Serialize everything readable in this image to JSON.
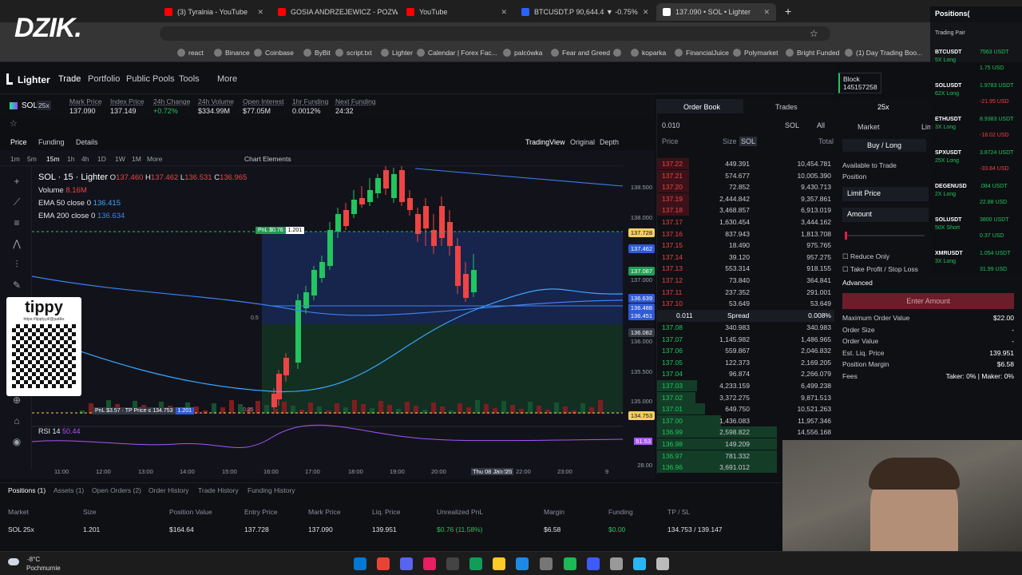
{
  "browser": {
    "tabs": [
      {
        "title": "(3) Tyralnia - YouTube",
        "fav": "#ff0000"
      },
      {
        "title": "GOSIA ANDRZEJEWICZ - POZW",
        "fav": "#ff0000"
      },
      {
        "title": "YouTube",
        "fav": "#ff0000"
      },
      {
        "title": "BTCUSDT.P 90,644.4 ▼ -0.75%",
        "fav": "#2962ff"
      },
      {
        "title": "137.090 • SOL • Lighter",
        "fav": "#ffffff"
      }
    ],
    "bookmarks": [
      "react",
      "Binance",
      "Coinbase",
      "ByBit",
      "script.txt",
      "Lighter",
      "Calendar | Forex Fac...",
      "palcówka",
      "Fear and Greed",
      "",
      "koparka",
      "FinancialJuice",
      "Polymarket",
      "Bright Funded",
      "(1) Day Trading Boo..."
    ],
    "watermark": "DZIK."
  },
  "nav": {
    "brand": "Lighter",
    "items": [
      "Trade",
      "Portfolio",
      "Public Pools",
      "Tools",
      "More"
    ],
    "block_label": "Block",
    "block_number": "145157258"
  },
  "market": {
    "symbol": "SOL",
    "leverage": "25x",
    "stats": [
      {
        "k": "Mark Price",
        "v": "137.090",
        "c": "#e2e4ea"
      },
      {
        "k": "Index Price",
        "v": "137.149",
        "c": "#e2e4ea"
      },
      {
        "k": "24h Change",
        "v": "+0.72%",
        "c": "#22c55e"
      },
      {
        "k": "24h Volume",
        "v": "$334.99M",
        "c": "#e2e4ea"
      },
      {
        "k": "Open Interest",
        "v": "$77.05M",
        "c": "#e2e4ea"
      },
      {
        "k": "1hr Funding",
        "v": "0.0012%",
        "c": "#e2e4ea"
      },
      {
        "k": "Next Funding",
        "v": "24:32",
        "c": "#e2e4ea"
      }
    ]
  },
  "chart_tabs": {
    "left": [
      "Price",
      "Funding",
      "Details"
    ],
    "right": [
      "TradingView",
      "Original",
      "Depth"
    ]
  },
  "chart_toolbar": {
    "intervals": [
      "1m",
      "5m",
      "15m",
      "1h",
      "4h",
      "1D",
      "1W",
      "1M",
      "More"
    ],
    "elements": "Chart Elements"
  },
  "chart_legend": {
    "title": "SOL · 15 · Lighter",
    "o": "137.460",
    "h": "137.462",
    "l": "136.531",
    "c": "136.965",
    "volume_label": "Volume",
    "volume": "8.16M",
    "ema50_label": "EMA 50 close 0",
    "ema50": "136.415",
    "ema200_label": "EMA 200 close 0",
    "ema200": "136.634",
    "rsi_label": "RSI 14",
    "rsi": "50.44"
  },
  "chart_data": {
    "type": "candlestick",
    "title": "SOL · 15 · Lighter",
    "x_ticks": [
      "11:00",
      "12:00",
      "13:00",
      "14:00",
      "15:00",
      "16:00",
      "17:00",
      "18:00",
      "19:00",
      "20:00",
      "Thu 08 Jan '26",
      "21:00",
      "22:00",
      "23:00",
      "9"
    ],
    "y_ticks": [
      "138.500",
      "138.000",
      "137.500",
      "137.000",
      "136.500",
      "136.000",
      "135.500",
      "135.000"
    ],
    "price_labels": [
      {
        "v": "137.728",
        "c": "#111111",
        "bg": "#f5d061"
      },
      {
        "v": "137.462",
        "c": "#ffffff",
        "bg": "#2f5bd6"
      },
      {
        "v": "137.087",
        "c": "#ffffff",
        "bg": "#1f9d55"
      },
      {
        "v": "136.639",
        "c": "#ffffff",
        "bg": "#2f5bd6"
      },
      {
        "v": "136.488",
        "c": "#ffffff",
        "bg": "#2f5bd6"
      },
      {
        "v": "136.451",
        "c": "#ffffff",
        "bg": "#2f5bd6"
      },
      {
        "v": "136.082",
        "c": "#ffffff",
        "bg": "#333844"
      },
      {
        "v": "134.753",
        "c": "#111111",
        "bg": "#f5d061"
      }
    ],
    "position_line": {
      "label": "PnL $0.76",
      "size": "1.201"
    },
    "tp_line": {
      "label": "PnL $3.57 · TP Price ≤ 134.753",
      "size": "1.201"
    },
    "rsi_ticks": [
      "51.53",
      "28.00"
    ],
    "fib": [
      "0.5",
      "0.25"
    ]
  },
  "orderbook": {
    "tabs": [
      "Order Book",
      "Trades"
    ],
    "tick": "0.010",
    "asset": "SOL",
    "filter": "All",
    "cols": [
      "Price",
      "Size",
      "SOL",
      "Total"
    ],
    "asks": [
      [
        "137.22",
        "449.391",
        "10,454.781"
      ],
      [
        "137.21",
        "574.677",
        "10,005.390"
      ],
      [
        "137.20",
        "72.852",
        "9,430.713"
      ],
      [
        "137.19",
        "2,444.842",
        "9,357.861"
      ],
      [
        "137.18",
        "3,468.857",
        "6,913.019"
      ],
      [
        "137.17",
        "1,630.454",
        "3,444.162"
      ],
      [
        "137.16",
        "837.943",
        "1,813.708"
      ],
      [
        "137.15",
        "18.490",
        "975.765"
      ],
      [
        "137.14",
        "39.120",
        "957.275"
      ],
      [
        "137.13",
        "553.314",
        "918.155"
      ],
      [
        "137.12",
        "73.840",
        "364.841"
      ],
      [
        "137.11",
        "237.352",
        "291.001"
      ],
      [
        "137.10",
        "53.649",
        "53.649"
      ]
    ],
    "spread": [
      "0.011",
      "Spread",
      "0.008%"
    ],
    "bids": [
      [
        "137.08",
        "340.983",
        "340.983"
      ],
      [
        "137.07",
        "1,145.982",
        "1,486.965"
      ],
      [
        "137.06",
        "559.867",
        "2,046.832"
      ],
      [
        "137.05",
        "122.373",
        "2,169.205"
      ],
      [
        "137.04",
        "96.874",
        "2,266.079"
      ],
      [
        "137.03",
        "4,233.159",
        "6,499.238"
      ],
      [
        "137.02",
        "3,372.275",
        "9,871.513"
      ],
      [
        "137.01",
        "649.750",
        "10,521.263"
      ],
      [
        "137.00",
        "1,436.083",
        "11,957.346"
      ],
      [
        "136.99",
        "2,598.822",
        "14,556.168"
      ],
      [
        "136.98",
        "149.209",
        ""
      ],
      [
        "136.97",
        "781.332",
        ""
      ],
      [
        "136.96",
        "3,691.012",
        ""
      ]
    ]
  },
  "order_form": {
    "leverage": "25x",
    "tabs": [
      "Market",
      "Lim"
    ],
    "side": "Buy / Long",
    "available": "Available to Trade",
    "position": "Position",
    "limit_price": "Limit Price",
    "amount": "Amount",
    "reduce_only": "Reduce Only",
    "tpsl": "Take Profit / Stop Loss",
    "advanced": "Advanced",
    "button": "Enter Amount",
    "rows": [
      [
        "Maximum Order Value",
        "$22.00"
      ],
      [
        "Order Size",
        "-"
      ],
      [
        "Order Value",
        "-"
      ],
      [
        "Est. Liq. Price",
        "139.951"
      ],
      [
        "Position Margin",
        "$6.58"
      ],
      [
        "Fees",
        "Taker: 0% | Maker: 0%"
      ]
    ]
  },
  "positions": {
    "tabs": [
      "Positions (1)",
      "Assets (1)",
      "Open Orders (2)",
      "Order History",
      "Trade History",
      "Funding History"
    ],
    "headers": [
      "Market",
      "Size",
      "Position Value",
      "Entry Price",
      "Mark Price",
      "Liq. Price",
      "Unrealized PnL",
      "Margin",
      "Funding",
      "TP / SL"
    ],
    "row": [
      "SOL 25x",
      "1.201",
      "$164.64",
      "137.728",
      "137.090",
      "139.951",
      "$0.76 (11.58%)",
      "$6.58",
      "$0.00",
      "134.753 / 139.147"
    ]
  },
  "overlay": {
    "title": "Positions(",
    "sub": "Trading Pair",
    "items": [
      {
        "pair": "BTCUSDT",
        "side": "5X Long",
        "v1": "7563 USDT",
        "v2": "1.75 USD"
      },
      {
        "pair": "SOLUSDT",
        "side": "62X Long",
        "v1": "1.9783 USDT",
        "v2": "-21.95 USD"
      },
      {
        "pair": "ETHUSDT",
        "side": "3X Long",
        "v1": "8.9383 USDT",
        "v2": "-18.02 USD"
      },
      {
        "pair": "SPXUSDT",
        "side": "25X Long",
        "v1": "3.8724 USDT",
        "v2": "-33.84 USD"
      },
      {
        "pair": "DEGENUSD",
        "side": "2X Long",
        "v1": ".084 USDT",
        "v2": "22.88 USD"
      },
      {
        "pair": "SOLUSDT",
        "side": "50X Short",
        "v1": "3800 USDT",
        "v2": "0.37 USD"
      },
      {
        "pair": "XMRUSDT",
        "side": "3X Long",
        "v1": "1.054 USDT",
        "v2": "31.99 USD"
      }
    ]
  },
  "sponsor": {
    "name": "tippy",
    "url": "https://tipply.pl/@patiks"
  },
  "weather": {
    "temp": "-8°C",
    "desc": "Pochmurnie"
  }
}
